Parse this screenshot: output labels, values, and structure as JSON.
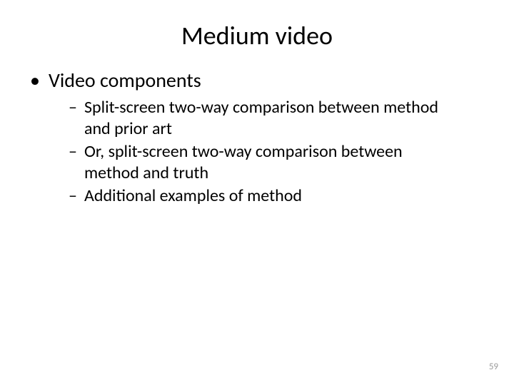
{
  "title": "Medium video",
  "bullet": {
    "marker": "•",
    "text": "Video components"
  },
  "subitems": [
    {
      "marker": "–",
      "text": "Split-screen two-way comparison between method and prior art"
    },
    {
      "marker": "–",
      "text": "Or, split-screen two-way comparison between method and truth"
    },
    {
      "marker": "–",
      "text": "Additional examples of method"
    }
  ],
  "page_number": "59"
}
